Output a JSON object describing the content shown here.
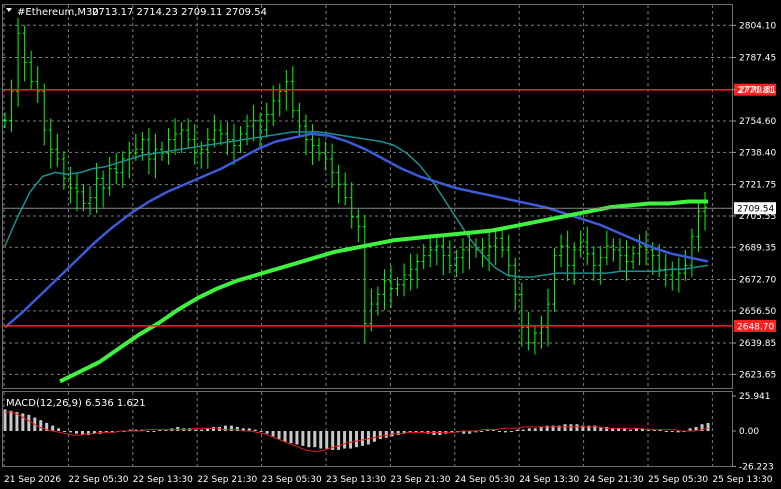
{
  "header": {
    "symbol": "#Ethereum,M30",
    "ohlc": "2713.17 2714.23 2709.11 2709.54"
  },
  "macd": {
    "label": "MACD(12,26,9) 6.536 1.621",
    "ticks": [
      "25.941",
      "0.00",
      "-26.223"
    ],
    "histogram": [
      16,
      15,
      14,
      13,
      12,
      10,
      8,
      6,
      4,
      2,
      0,
      -1,
      -2,
      -3,
      -3,
      -2,
      -2,
      -1,
      -1,
      0,
      0,
      1,
      1,
      1,
      0,
      0,
      1,
      1,
      2,
      3,
      2,
      2,
      1,
      1,
      2,
      3,
      3,
      4,
      4,
      3,
      2,
      2,
      1,
      0,
      -2,
      -4,
      -6,
      -8,
      -9,
      -10,
      -11,
      -12,
      -12,
      -13,
      -13,
      -14,
      -14,
      -13,
      -13,
      -12,
      -11,
      -10,
      -8,
      -6,
      -5,
      -4,
      -3,
      -2,
      -1,
      0,
      -1,
      -2,
      -3,
      -3,
      -2,
      -1,
      -1,
      -2,
      -2,
      -1,
      0,
      1,
      1,
      0,
      -1,
      0,
      1,
      1,
      2,
      2,
      3,
      4,
      4,
      4,
      5,
      5,
      5,
      4,
      4,
      4,
      3,
      3,
      2,
      2,
      2,
      1,
      2,
      2,
      1,
      1,
      1,
      0,
      0,
      -1,
      0,
      2,
      3,
      5,
      6
    ],
    "signal": [
      14,
      14,
      12,
      9,
      6,
      3,
      1,
      0,
      -1,
      -2,
      -3,
      -3,
      -2,
      -2,
      -1,
      -1,
      -1,
      0,
      0,
      0,
      0,
      1,
      1,
      1,
      1,
      1,
      1,
      1,
      2,
      2,
      2,
      2,
      1,
      1,
      1,
      0,
      0,
      -1,
      -2,
      -4,
      -6,
      -8,
      -10,
      -12,
      -14,
      -15,
      -15,
      -14,
      -12,
      -11,
      -9,
      -8,
      -7,
      -6,
      -5,
      -4,
      -3,
      -2,
      -2,
      -1,
      -1,
      -1,
      -1,
      -1,
      -1,
      -1,
      -1,
      0,
      0,
      0,
      1,
      1,
      1,
      2,
      2,
      2,
      3,
      3,
      3,
      3,
      3,
      3,
      3,
      3,
      3,
      3,
      3,
      3,
      2,
      2,
      2,
      2,
      2,
      2,
      1,
      1,
      1,
      1,
      1,
      0,
      0,
      0,
      1,
      2
    ]
  },
  "chart_data": {
    "type": "line",
    "title": "#Ethereum,M30",
    "price_axis": {
      "ylim": [
        2616.6,
        2814.6
      ],
      "ticks": [
        2804.1,
        2787.45,
        2770.81,
        2754.6,
        2738.4,
        2721.75,
        2705.55,
        2689.35,
        2672.7,
        2656.5,
        2639.85,
        2623.65
      ],
      "tick_labels": [
        "2804.10",
        "2787.45",
        "2770.81",
        "2754.60",
        "2738.40",
        "2721.75",
        "2705.55",
        "2689.35",
        "2672.70",
        "2656.50",
        "2639.85",
        "2623.65"
      ]
    },
    "x_tick_labels": [
      "21 Sep 2026",
      "22 Sep 05:30",
      "22 Sep 13:30",
      "22 Sep 21:30",
      "23 Sep 05:30",
      "23 Sep 13:30",
      "23 Sep 21:30",
      "24 Sep 05:30",
      "24 Sep 13:30",
      "24 Sep 21:30",
      "25 Sep 05:30",
      "25 Sep 13:30"
    ],
    "horizontal_levels": [
      {
        "value": 2770.81,
        "label": "2770.81",
        "color": "#ff2020"
      },
      {
        "value": 2648.7,
        "label": "2648.70",
        "color": "#ff2020"
      }
    ],
    "current_price": {
      "value": 2709.54,
      "label": "2709.54"
    },
    "close": [
      2755,
      2770,
      2800,
      2785,
      2775,
      2770,
      2750,
      2740,
      2735,
      2725,
      2720,
      2718,
      2712,
      2715,
      2725,
      2720,
      2730,
      2728,
      2735,
      2738,
      2740,
      2745,
      2735,
      2740,
      2738,
      2745,
      2748,
      2750,
      2745,
      2738,
      2740,
      2745,
      2750,
      2748,
      2745,
      2742,
      2748,
      2752,
      2755,
      2750,
      2758,
      2765,
      2770,
      2775,
      2760,
      2752,
      2745,
      2742,
      2738,
      2735,
      2728,
      2722,
      2715,
      2705,
      2700,
      2650,
      2660,
      2665,
      2672,
      2668,
      2670,
      2675,
      2678,
      2682,
      2685,
      2688,
      2690,
      2685,
      2680,
      2684,
      2688,
      2690,
      2688,
      2685,
      2690,
      2694,
      2688,
      2680,
      2665,
      2648,
      2640,
      2645,
      2648,
      2660,
      2685,
      2690,
      2680,
      2688,
      2692,
      2686,
      2680,
      2684,
      2690,
      2688,
      2685,
      2682,
      2686,
      2690,
      2688,
      2685,
      2678,
      2675,
      2678,
      2676,
      2680,
      2695,
      2708,
      2710
    ],
    "series": [
      {
        "name": "MA fast",
        "color": "#1e8f8f",
        "values": [
          2690,
          2705,
          2718,
          2726,
          2728,
          2727,
          2728,
          2730,
          2731,
          2733,
          2735,
          2737,
          2738,
          2739,
          2740,
          2741,
          2742,
          2743,
          2744,
          2745,
          2746,
          2747,
          2748,
          2749,
          2749,
          2749,
          2748,
          2747,
          2746,
          2745,
          2744,
          2742,
          2738,
          2732,
          2724,
          2714,
          2704,
          2694,
          2686,
          2679,
          2675,
          2674,
          2674,
          2675,
          2676,
          2676,
          2676,
          2676,
          2676,
          2677,
          2677,
          2677,
          2677,
          2678,
          2678,
          2679,
          2680
        ]
      },
      {
        "name": "MA mid",
        "color": "#3d5ad8",
        "values": [
          2648,
          2656,
          2665,
          2674,
          2683,
          2692,
          2700,
          2707,
          2713,
          2718,
          2722,
          2726,
          2730,
          2735,
          2740,
          2744,
          2746,
          2748,
          2747,
          2744,
          2740,
          2735,
          2730,
          2726,
          2723,
          2720,
          2718,
          2716,
          2714,
          2712,
          2710,
          2707,
          2704,
          2701,
          2697,
          2693,
          2689,
          2686,
          2684,
          2682
        ]
      },
      {
        "name": "MA slow",
        "color": "#3ff23f",
        "values": [
          2620,
          2625,
          2630,
          2637,
          2644,
          2650,
          2657,
          2663,
          2668,
          2672,
          2675,
          2678,
          2681,
          2684,
          2687,
          2689,
          2691,
          2693,
          2694,
          2695,
          2696,
          2697,
          2698,
          2700,
          2702,
          2704,
          2706,
          2708,
          2710,
          2711,
          2712,
          2712,
          2713,
          2713
        ]
      }
    ]
  }
}
